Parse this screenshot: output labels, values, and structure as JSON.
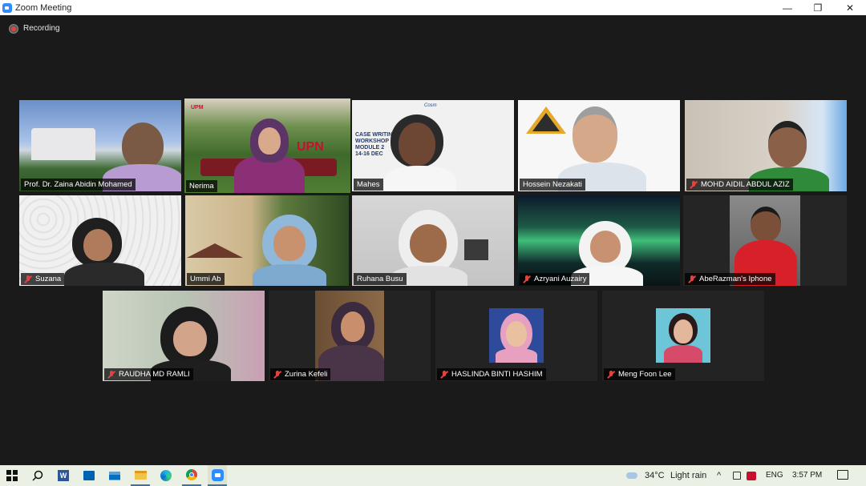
{
  "window": {
    "title": "Zoom Meeting",
    "controls": [
      "—",
      "❐",
      "✕"
    ]
  },
  "recording": {
    "label": "Recording"
  },
  "participants": [
    {
      "name": "Prof. Dr. Zaina  Abidin Mohamed",
      "muted": false,
      "active": false
    },
    {
      "name": "Nerima",
      "muted": false,
      "active": true
    },
    {
      "name": "Mahes",
      "muted": false,
      "active": false
    },
    {
      "name": "Hossein Nezakati",
      "muted": false,
      "active": false
    },
    {
      "name": "MOHD AIDIL ABDUL AZIZ",
      "muted": true,
      "active": false
    },
    {
      "name": "Suzana",
      "muted": true,
      "active": false
    },
    {
      "name": "Ummi Ab",
      "muted": false,
      "active": false
    },
    {
      "name": "Ruhana Busu",
      "muted": false,
      "active": false
    },
    {
      "name": "Azryani Auzairy",
      "muted": true,
      "active": false
    },
    {
      "name": "AbeRazman's Iphone",
      "muted": true,
      "active": false
    },
    {
      "name": "RAUDHA MD RAMLI",
      "muted": true,
      "active": false
    },
    {
      "name": "Zurina Kefeli",
      "muted": true,
      "active": false
    },
    {
      "name": "HASLINDA BINTI HASHIM",
      "muted": true,
      "active": false
    },
    {
      "name": "Meng Foon Lee",
      "muted": true,
      "active": false
    }
  ],
  "tile_texts": {
    "upm_logo": "UPM",
    "upn_sign": "UPN",
    "case_slide": [
      "CASE WRITIN",
      "WORKSHOP",
      "MODULE 2",
      "14-16 DEC"
    ],
    "case_logo": "Cosm"
  },
  "taskbar": {
    "weather_temp": "34°C",
    "weather_desc": "Light rain",
    "language": "ENG",
    "time": "3:57 PM"
  },
  "colors": {
    "active_speaker": "#d6e64a",
    "mute": "#e34242",
    "taskbar": "#eaf0e3"
  }
}
